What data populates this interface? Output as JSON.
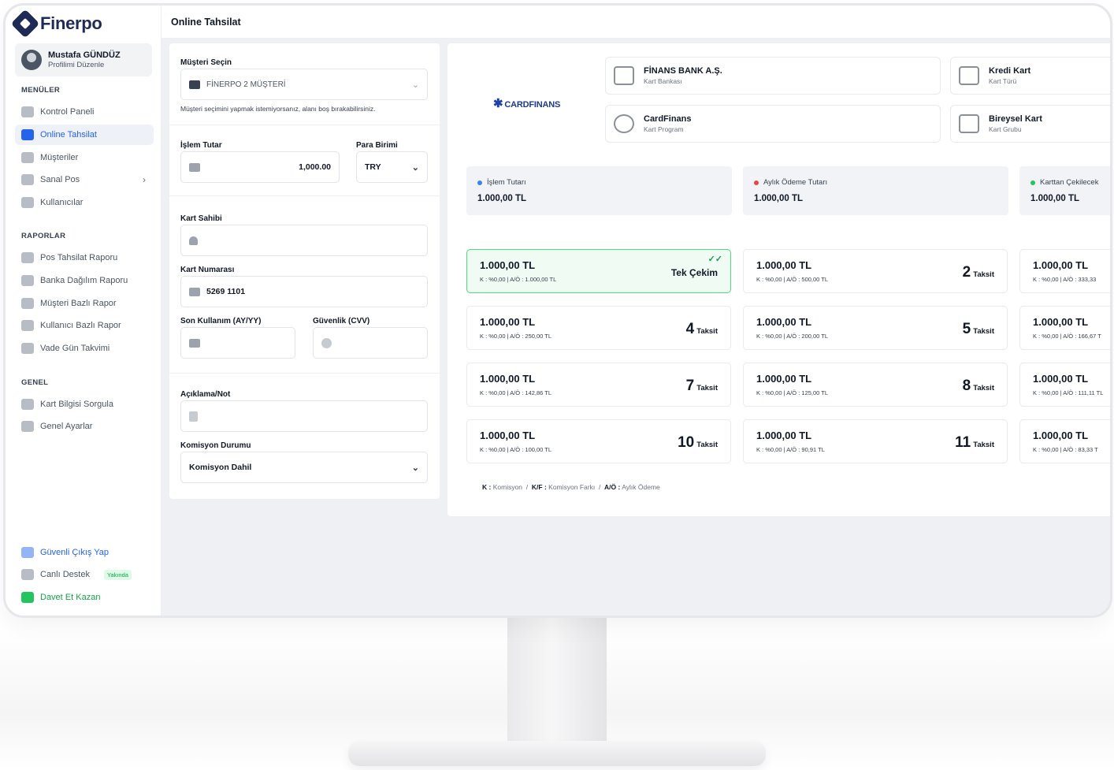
{
  "app": {
    "name": "Finerpo",
    "page_title": "Online Tahsilat"
  },
  "profile": {
    "name": "Mustafa GÜNDÜZ",
    "sub": "Profilimi Düzenle"
  },
  "sidebar": {
    "menus_header": "MENÜLER",
    "menus": [
      {
        "label": "Kontrol Paneli",
        "icon": "dashboard-icon"
      },
      {
        "label": "Online Tahsilat",
        "icon": "card-icon",
        "active": true
      },
      {
        "label": "Müşteriler",
        "icon": "users-icon"
      },
      {
        "label": "Sanal Pos",
        "icon": "pos-icon",
        "has_submenu": true
      },
      {
        "label": "Kullanıcılar",
        "icon": "user-group-icon"
      }
    ],
    "reports_header": "RAPORLAR",
    "reports": [
      {
        "label": "Pos Tahsilat Raporu",
        "icon": "pie-icon"
      },
      {
        "label": "Banka Dağılım Raporu",
        "icon": "bar-chart-icon"
      },
      {
        "label": "Müşteri Bazlı Rapor",
        "icon": "id-card-icon"
      },
      {
        "label": "Kullanıcı Bazlı Rapor",
        "icon": "pie-icon"
      },
      {
        "label": "Vade Gün Takvimi",
        "icon": "calendar-icon"
      }
    ],
    "general_header": "GENEL",
    "general": [
      {
        "label": "Kart Bilgisi Sorgula",
        "icon": "scan-icon"
      },
      {
        "label": "Genel Ayarlar",
        "icon": "gear-icon"
      }
    ],
    "footer": [
      {
        "label": "Güvenli Çıkış Yap",
        "icon": "shield-icon"
      },
      {
        "label": "Canlı Destek",
        "icon": "support-icon",
        "badge": "Yakında"
      },
      {
        "label": "Davet Et Kazan",
        "icon": "gift-icon"
      }
    ]
  },
  "form": {
    "customer_label": "Müşteri Seçin",
    "customer_value": "FİNERPO 2 MÜŞTERİ",
    "customer_hint": "Müşteri seçimini yapmak istemiyorsanız, alanı boş bırakabilirsiniz.",
    "amount_label": "İşlem Tutar",
    "amount_value": "1,000.00",
    "currency_label": "Para Birimi",
    "currency_value": "TRY",
    "holder_label": "Kart Sahibi",
    "holder_value": "",
    "card_number_label": "Kart Numarası",
    "card_number_value": "5269 1101",
    "expiry_label": "Son Kullanım (AY/YY)",
    "cvv_label": "Güvenlik (CVV)",
    "note_label": "Açıklama/Not",
    "commission_label": "Komisyon Durumu",
    "commission_value": "Komisyon Dahil"
  },
  "card_info": {
    "logo_text": "CARDFINANS",
    "bank_title": "FİNANS BANK A.Ş.",
    "bank_sub": "Kart Bankası",
    "type_title": "Kredi Kart",
    "type_sub": "Kart Türü",
    "program_title": "CardFinans",
    "program_sub": "Kart Program",
    "group_title": "Bireysel Kart",
    "group_sub": "Kart Grubu"
  },
  "summary": [
    {
      "label": "İşlem Tutarı",
      "value": "1.000,00 TL",
      "color": "#3b82f6"
    },
    {
      "label": "Aylık Ödeme Tutarı",
      "value": "1.000,00 TL",
      "color": "#ef4444"
    },
    {
      "label": "Karttan Çekilecek",
      "value": "1.000,00 TL",
      "color": "#22c55e"
    }
  ],
  "installments": [
    {
      "amount": "1.000,00 TL",
      "detail": "K : %0,00 | A/Ö : 1.000,00 TL",
      "label": "Tek Çekim",
      "selected": true
    },
    {
      "amount": "1.000,00 TL",
      "detail": "K : %0,00 | A/Ö : 500,00 TL",
      "count": "2",
      "unit": "Taksit"
    },
    {
      "amount": "1.000,00 TL",
      "detail": "K : %0,00 | A/Ö : 333,33",
      "count": "",
      "unit": ""
    },
    {
      "amount": "1.000,00 TL",
      "detail": "K : %0,00 | A/Ö : 250,00 TL",
      "count": "4",
      "unit": "Taksit"
    },
    {
      "amount": "1.000,00 TL",
      "detail": "K : %0,00 | A/Ö : 200,00 TL",
      "count": "5",
      "unit": "Taksit"
    },
    {
      "amount": "1.000,00 TL",
      "detail": "K : %0,00 | A/Ö : 166,67 T",
      "count": "",
      "unit": ""
    },
    {
      "amount": "1.000,00 TL",
      "detail": "K : %0,00 | A/Ö : 142,86 TL",
      "count": "7",
      "unit": "Taksit"
    },
    {
      "amount": "1.000,00 TL",
      "detail": "K : %0,00 | A/Ö : 125,00 TL",
      "count": "8",
      "unit": "Taksit"
    },
    {
      "amount": "1.000,00 TL",
      "detail": "K : %0,00 | A/Ö : 111,11 TL",
      "count": "",
      "unit": ""
    },
    {
      "amount": "1.000,00 TL",
      "detail": "K : %0,00 | A/Ö : 100,00 TL",
      "count": "10",
      "unit": "Taksit"
    },
    {
      "amount": "1.000,00 TL",
      "detail": "K : %0,00 | A/Ö : 90,91 TL",
      "count": "11",
      "unit": "Taksit"
    },
    {
      "amount": "1.000,00 TL",
      "detail": "K : %0,00 | A/Ö : 83,33 T",
      "count": "",
      "unit": ""
    }
  ],
  "legend": {
    "k": "K :",
    "k_text": "Komisyon",
    "kf": "K/F :",
    "kf_text": "Komisyon Farkı",
    "ao": "A/Ö :",
    "ao_text": "Aylık Ödeme",
    "sep": "/"
  }
}
